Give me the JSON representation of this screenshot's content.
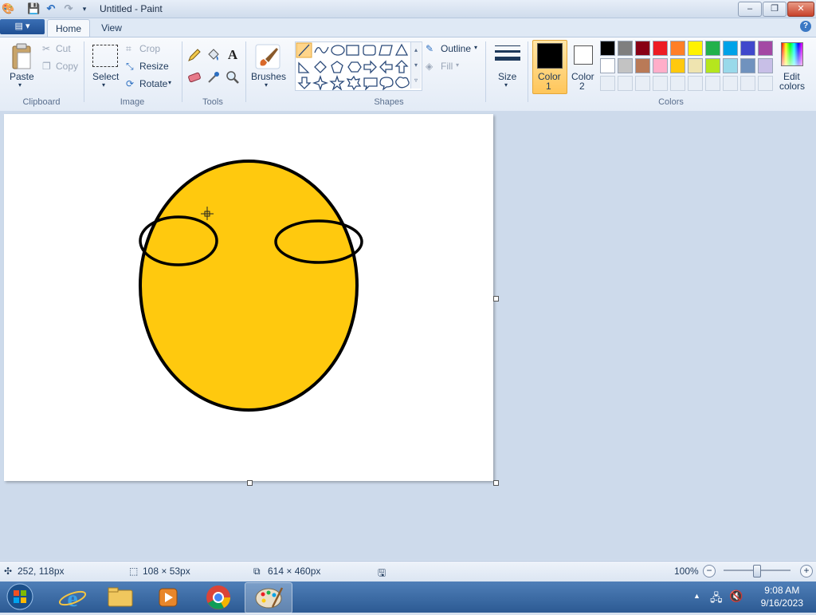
{
  "window": {
    "title": "Untitled - Paint",
    "controls": {
      "minimize": "–",
      "maximize": "❐",
      "close": "✕"
    }
  },
  "tabs": {
    "file": "▤ ▾",
    "home": "Home",
    "view": "View",
    "help": "?"
  },
  "ribbon": {
    "clipboard": {
      "paste": "Paste",
      "cut": "Cut",
      "copy": "Copy",
      "group": "Clipboard"
    },
    "image": {
      "select": "Select",
      "crop": "Crop",
      "resize": "Resize",
      "rotate": "Rotate",
      "group": "Image"
    },
    "tools": {
      "group": "Tools"
    },
    "brushes": {
      "label": "Brushes"
    },
    "shapes": {
      "outline": "Outline",
      "fill": "Fill",
      "group": "Shapes"
    },
    "size": {
      "label": "Size"
    },
    "color1": {
      "label_line1": "Color",
      "label_line2": "1",
      "value": "#000000"
    },
    "color2": {
      "label_line1": "Color",
      "label_line2": "2",
      "value": "#ffffff"
    },
    "colors": {
      "group": "Colors",
      "edit_line1": "Edit",
      "edit_line2": "colors",
      "row1": [
        "#000000",
        "#7f7f7f",
        "#880015",
        "#ed1c24",
        "#ff7f27",
        "#fff200",
        "#22b14c",
        "#00a2e8",
        "#3f48cc",
        "#a349a4"
      ],
      "row2": [
        "#ffffff",
        "#c3c3c3",
        "#b97a57",
        "#ffaec9",
        "#ffc90e",
        "#efe4b0",
        "#b5e61d",
        "#99d9ea",
        "#7092be",
        "#c8bfe7"
      ]
    }
  },
  "canvas": {
    "face_color": "#ffc90e",
    "outline_color": "#000000"
  },
  "status": {
    "cursor_pos": "252, 118px",
    "selection_size": "108 × 53px",
    "canvas_size": "614 × 460px",
    "zoom": "100%",
    "zoom_level": 0.5
  },
  "taskbar": {
    "time": "9:08 AM",
    "date": "9/16/2023"
  }
}
